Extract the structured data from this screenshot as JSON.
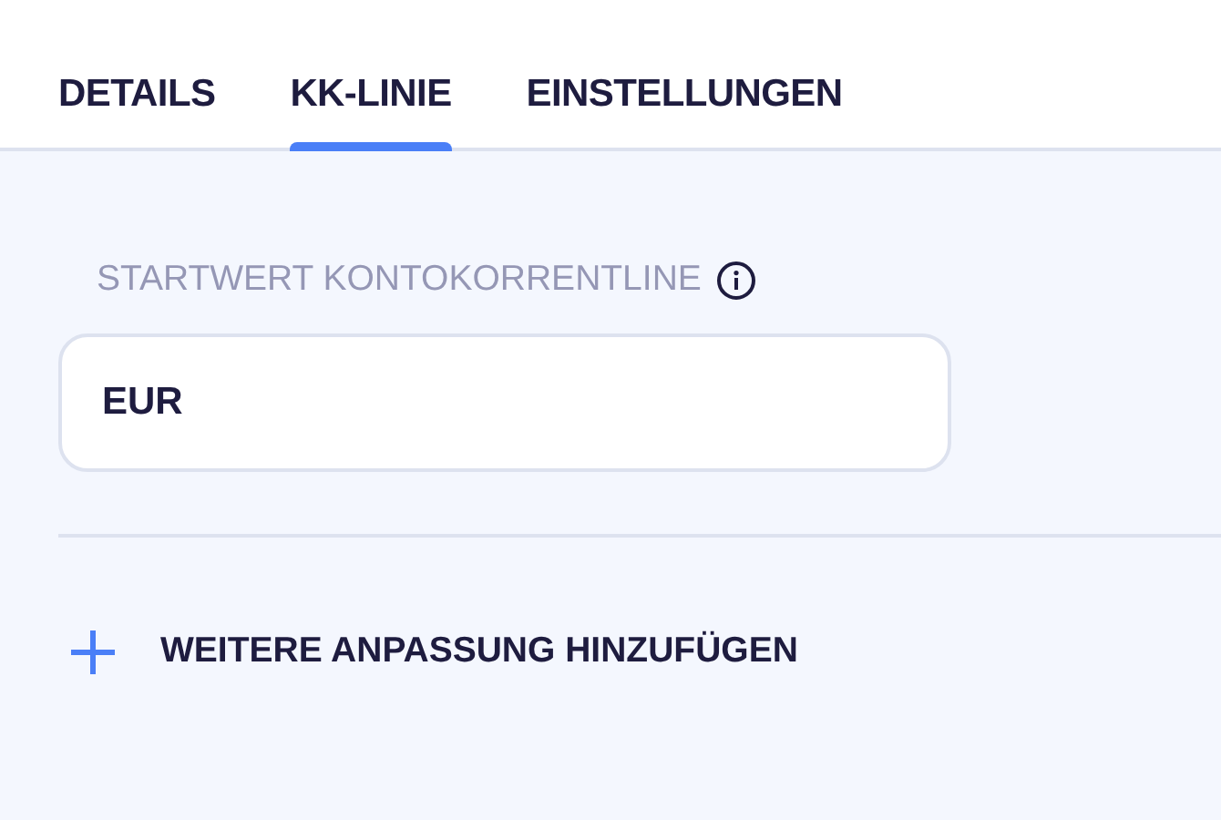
{
  "tabs": [
    {
      "label": "DETAILS",
      "selected": false
    },
    {
      "label": "KK-LINIE",
      "selected": true
    },
    {
      "label": "EINSTELLUNGEN",
      "selected": false
    }
  ],
  "field": {
    "label": "STARTWERT KONTOKORRENTLINE",
    "value": "EUR"
  },
  "add_button": {
    "label": "WEITERE ANPASSUNG HINZUFÜGEN"
  }
}
